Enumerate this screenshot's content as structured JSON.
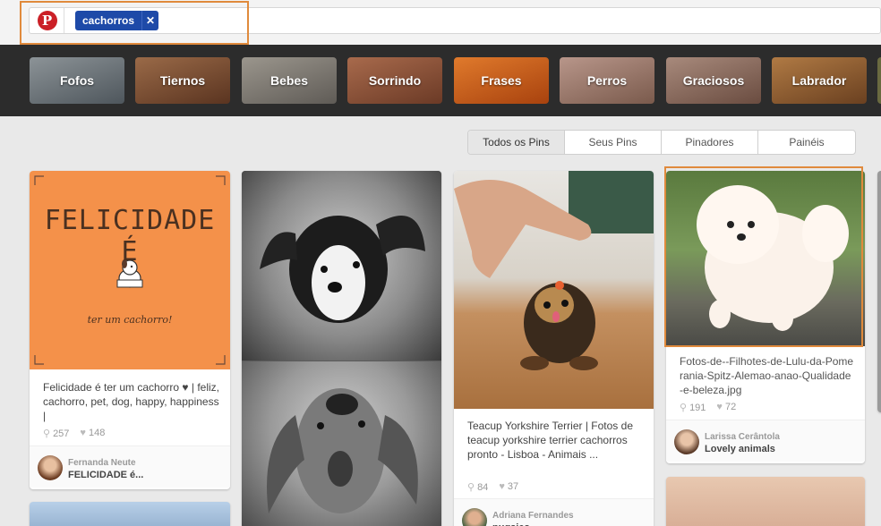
{
  "search": {
    "tag_label": "cachorros",
    "remove_icon": "close-icon"
  },
  "brand": {
    "logo_letter": "P",
    "color": "#cb2027"
  },
  "categories": [
    {
      "label": "Fofos",
      "color": "#6c7378"
    },
    {
      "label": "Tiernos",
      "color": "#7a4a30"
    },
    {
      "label": "Bebes",
      "color": "#7d7973"
    },
    {
      "label": "Sorrindo",
      "color": "#8a5238"
    },
    {
      "label": "Frases",
      "color": "#c2561c"
    },
    {
      "label": "Perros",
      "color": "#a07a66"
    },
    {
      "label": "Graciosos",
      "color": "#8a6a5a"
    },
    {
      "label": "Labrador",
      "color": "#8a5a2e"
    }
  ],
  "tabs": [
    {
      "label": "Todos os Pins"
    },
    {
      "label": "Seus Pins"
    },
    {
      "label": "Pinadores"
    },
    {
      "label": "Painéis"
    }
  ],
  "pins": [
    {
      "image_text_title": "FELICIDADE É",
      "image_text_sub": "ter um cachorro!",
      "description": "Felicidade é ter um cachorro ♥ | feliz, cachorro, pet, dog, happy, happiness |",
      "repins": "257",
      "likes": "148",
      "pinner": "Fernanda Neute",
      "board": "FELICIDADE é..."
    },
    {
      "description": "Teacup Yorkshire Terrier | Fotos de teacup yorkshire terrier cachorros pronto - Lisboa - Animais ...",
      "repins": "84",
      "likes": "37",
      "pinner": "Adriana Fernandes",
      "board": "pugsies"
    },
    {
      "description": "Fotos-de--Filhotes-de-Lulu-da-Pomerania-Spitz-Alemao-anao-Qualidade-e-beleza.jpg",
      "repins": "191",
      "likes": "72",
      "pinner": "Larissa Cerântola",
      "board": "Lovely animals"
    }
  ],
  "colors": {
    "highlight": "#e08a3c",
    "tag_bg": "#1e4aa8",
    "strip_bg": "#2c2c2c"
  }
}
